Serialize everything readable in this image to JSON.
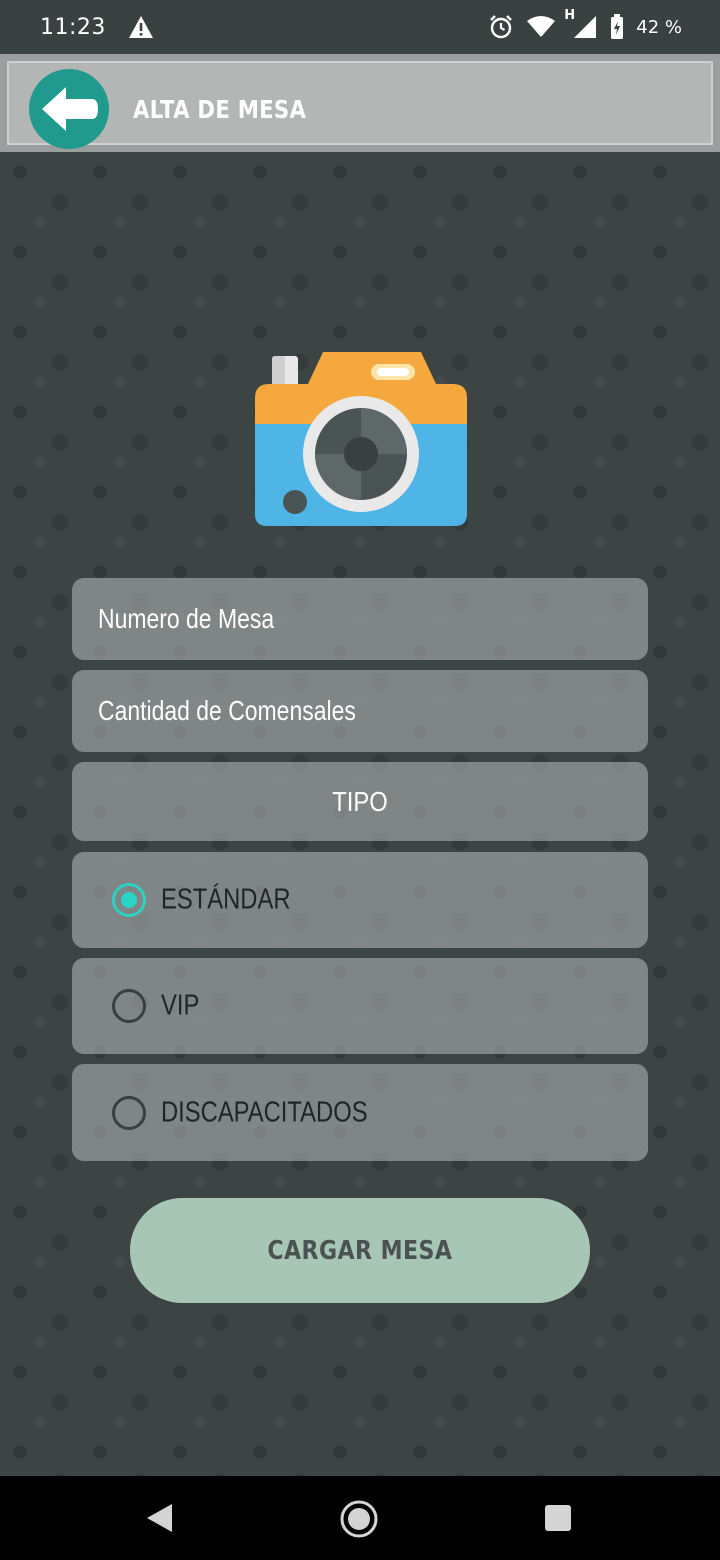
{
  "status_bar": {
    "time": "11:23",
    "network_type": "H",
    "battery": "42 %",
    "icons": [
      "warning-icon",
      "alarm-icon",
      "wifi-icon",
      "signal-icon",
      "battery-icon"
    ]
  },
  "app_bar": {
    "title": "ALTA DE MESA",
    "back_icon": "arrow-left-icon",
    "back_color": "#1f9a8c"
  },
  "form": {
    "table_number_placeholder": "Numero de Mesa",
    "diners_placeholder": "Cantidad de Comensales",
    "type_label": "TIPO",
    "options": [
      {
        "label": "ESTÁNDAR",
        "checked": true
      },
      {
        "label": "VIP",
        "checked": false
      },
      {
        "label": "DISCAPACITADOS",
        "checked": false
      }
    ],
    "submit_label": "CARGAR MESA"
  },
  "colors": {
    "accent": "#2bd3c4",
    "button": "#a8c6b6",
    "background": "#3d4444"
  }
}
